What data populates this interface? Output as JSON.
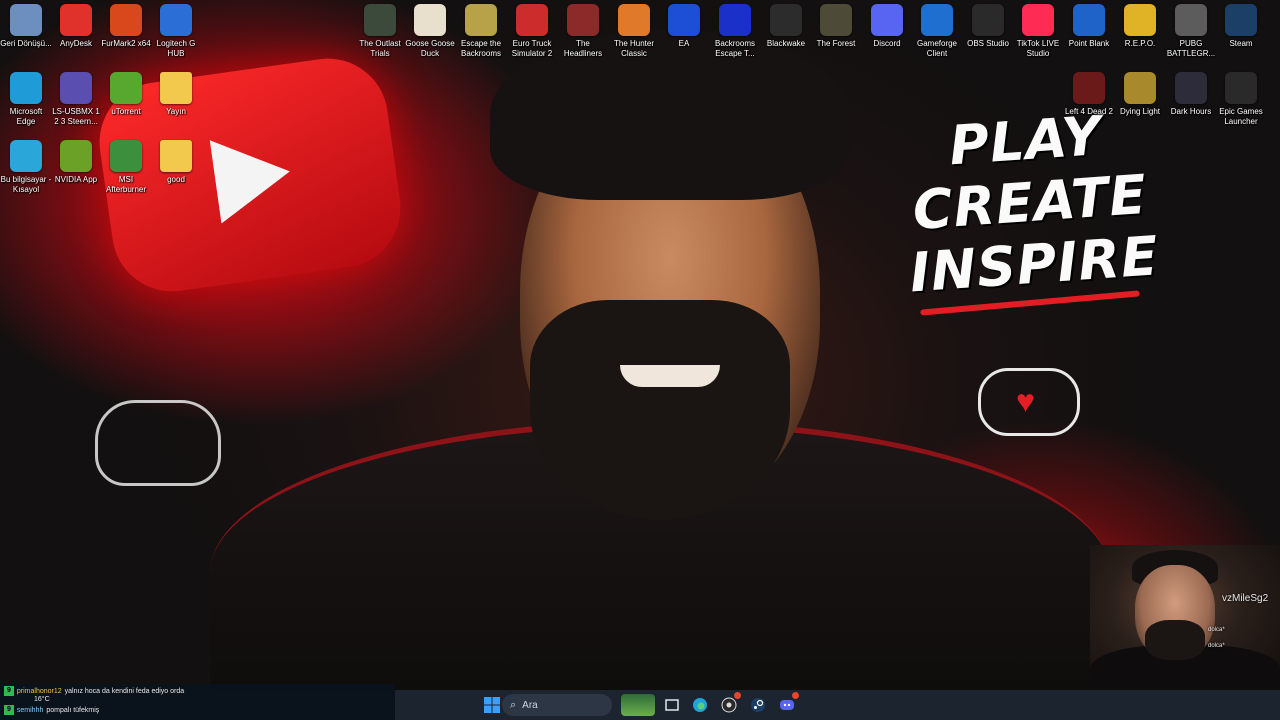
{
  "slogan": {
    "line1": "PLAY",
    "line2": "CREATE",
    "line3": "INSPIRE"
  },
  "desktop_icons": [
    {
      "label": "Geri Dönüşü...",
      "icon": "recycle-bin-icon",
      "color": "#6c8fbf"
    },
    {
      "label": "AnyDesk",
      "icon": "anydesk-icon",
      "color": "#e0322b"
    },
    {
      "label": "FurMark2 x64",
      "icon": "furmark-icon",
      "color": "#d9471c"
    },
    {
      "label": "Logitech G HUB",
      "icon": "logitech-ghub-icon",
      "color": "#2b6fd6"
    },
    {
      "label": "Microsoft Edge",
      "icon": "edge-icon",
      "color": "#1f9bd8"
    },
    {
      "label": "LS-USBMX 1 2 3 Steern...",
      "icon": "ls-usbmx-icon",
      "color": "#5a4fb0"
    },
    {
      "label": "uTorrent",
      "icon": "utorrent-icon",
      "color": "#58a82f"
    },
    {
      "label": "Yayın",
      "icon": "folder-icon",
      "color": "#f2c94c"
    },
    {
      "label": "Bu bilgisayar - Kısayol",
      "icon": "this-pc-icon",
      "color": "#2aa6d9"
    },
    {
      "label": "NVIDIA App",
      "icon": "nvidia-icon",
      "color": "#6aa126"
    },
    {
      "label": "MSI Afterburner",
      "icon": "msi-afterburner-icon",
      "color": "#3c8f3c"
    },
    {
      "label": "good",
      "icon": "folder-icon",
      "color": "#f2c94c"
    },
    {
      "label": "The Outlast Trials",
      "icon": "outlast-trials-icon",
      "color": "#3b4a3a"
    },
    {
      "label": "Goose Goose Duck",
      "icon": "goose-goose-duck-icon",
      "color": "#e8e0cc"
    },
    {
      "label": "Escape the Backrooms",
      "icon": "escape-backrooms-icon",
      "color": "#b7a24a"
    },
    {
      "label": "Euro Truck Simulator 2",
      "icon": "euro-truck-icon",
      "color": "#cc2c2c"
    },
    {
      "label": "The Headliners",
      "icon": "headliners-icon",
      "color": "#8c2a2a"
    },
    {
      "label": "The Hunter Classic",
      "icon": "thehunter-icon",
      "color": "#e07a2a"
    },
    {
      "label": "EA",
      "icon": "ea-icon",
      "color": "#1d4fd6"
    },
    {
      "label": "Backrooms Escape T...",
      "icon": "backrooms-escape-icon",
      "color": "#1b2fc9"
    },
    {
      "label": "Blackwake",
      "icon": "blackwake-icon",
      "color": "#2c2c2c"
    },
    {
      "label": "The Forest",
      "icon": "the-forest-icon",
      "color": "#4d4a38"
    },
    {
      "label": "Discord",
      "icon": "discord-icon",
      "color": "#5865f2"
    },
    {
      "label": "Gameforge Client",
      "icon": "gameforge-icon",
      "color": "#1e6fd0"
    },
    {
      "label": "OBS Studio",
      "icon": "obs-icon",
      "color": "#2a2a2a"
    },
    {
      "label": "TikTok LIVE Studio",
      "icon": "tiktok-live-icon",
      "color": "#fe2c55"
    },
    {
      "label": "Point Blank",
      "icon": "point-blank-icon",
      "color": "#1f62c8"
    },
    {
      "label": "R.E.P.O.",
      "icon": "repo-icon",
      "color": "#e0b326"
    },
    {
      "label": "PUBG BATTLEGR...",
      "icon": "pubg-icon",
      "color": "#5c5c5c"
    },
    {
      "label": "Steam",
      "icon": "steam-icon",
      "color": "#1b3f67"
    },
    {
      "label": "Left 4 Dead 2",
      "icon": "left4dead2-icon",
      "color": "#6b1a1a"
    },
    {
      "label": "Dying Light",
      "icon": "dying-light-icon",
      "color": "#a88a2c"
    },
    {
      "label": "Dark Hours",
      "icon": "dark-hours-icon",
      "color": "#2c2c3a"
    },
    {
      "label": "Epic Games Launcher",
      "icon": "epic-games-icon",
      "color": "#2a2a2a"
    }
  ],
  "webcam": {
    "username": "vzMileSg2",
    "line1": "dolca*",
    "line2": "dolca*"
  },
  "chat": [
    {
      "badge": "9",
      "user": "primalhonor12",
      "message": "yalnız hoca da kendini feda ediyo orda"
    },
    {
      "badge": "9",
      "user": "semihhh",
      "message": "pompalı tüfekmiş"
    }
  ],
  "weather": "16°C",
  "taskbar": {
    "search_placeholder": "Ara",
    "apps": [
      "start-icon",
      "file-explorer-icon",
      "edge-icon",
      "obs-icon",
      "steam-icon",
      "discord-icon"
    ]
  }
}
